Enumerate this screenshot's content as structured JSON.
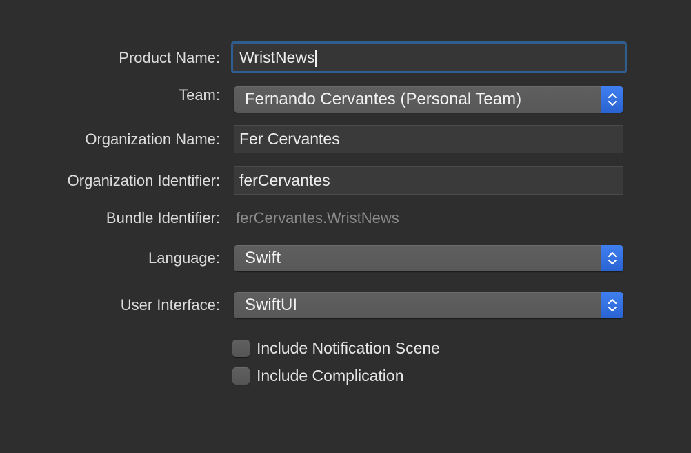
{
  "form": {
    "product_name": {
      "label": "Product Name:",
      "value": "WristNews"
    },
    "team": {
      "label": "Team:",
      "value": "Fernando Cervantes (Personal Team)"
    },
    "organization_name": {
      "label": "Organization Name:",
      "value": "Fer Cervantes"
    },
    "organization_identifier": {
      "label": "Organization Identifier:",
      "value": "ferCervantes"
    },
    "bundle_identifier": {
      "label": "Bundle Identifier:",
      "value": "ferCervantes.WristNews"
    },
    "language": {
      "label": "Language:",
      "value": "Swift"
    },
    "user_interface": {
      "label": "User Interface:",
      "value": "SwiftUI"
    },
    "options": [
      {
        "label": "Include Notification Scene",
        "checked": false
      },
      {
        "label": "Include Complication",
        "checked": false
      }
    ]
  },
  "icons": {
    "popup_stepper": "chevron-up-down-icon"
  },
  "colors": {
    "background": "#2e2e2e",
    "accent": "#2f6bdf",
    "focus_ring": "#2f5e8e",
    "secondary_text": "#8a8a8a"
  }
}
